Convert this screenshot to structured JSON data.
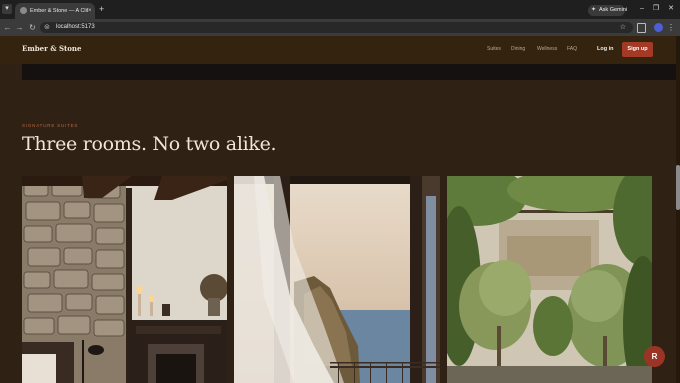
{
  "browser": {
    "tab_title": "Ember & Stone — A Clifftside Retreat",
    "tab_close": "×",
    "new_tab": "+",
    "ask_label": "Ask Gemini",
    "url": "localhost:5173"
  },
  "site": {
    "brand": "Ember & Stone",
    "nav": [
      "Suites",
      "Dining",
      "Wellness",
      "FAQ"
    ],
    "login": "Log in",
    "signup": "Sign up"
  },
  "section": {
    "eyebrow": "SIGNATURE SUITES",
    "headline": "Three rooms. No two alike."
  },
  "cards": [
    {
      "icon": "stone-fireplace-room-photo"
    },
    {
      "icon": "sea-view-window-photo"
    },
    {
      "icon": "garden-courtyard-photo"
    }
  ],
  "chat_avatar": "R",
  "colors": {
    "page_bg": "#2f2113",
    "accent": "#a23a25",
    "heading": "#efe6d8",
    "eyebrow": "#b46a48"
  }
}
